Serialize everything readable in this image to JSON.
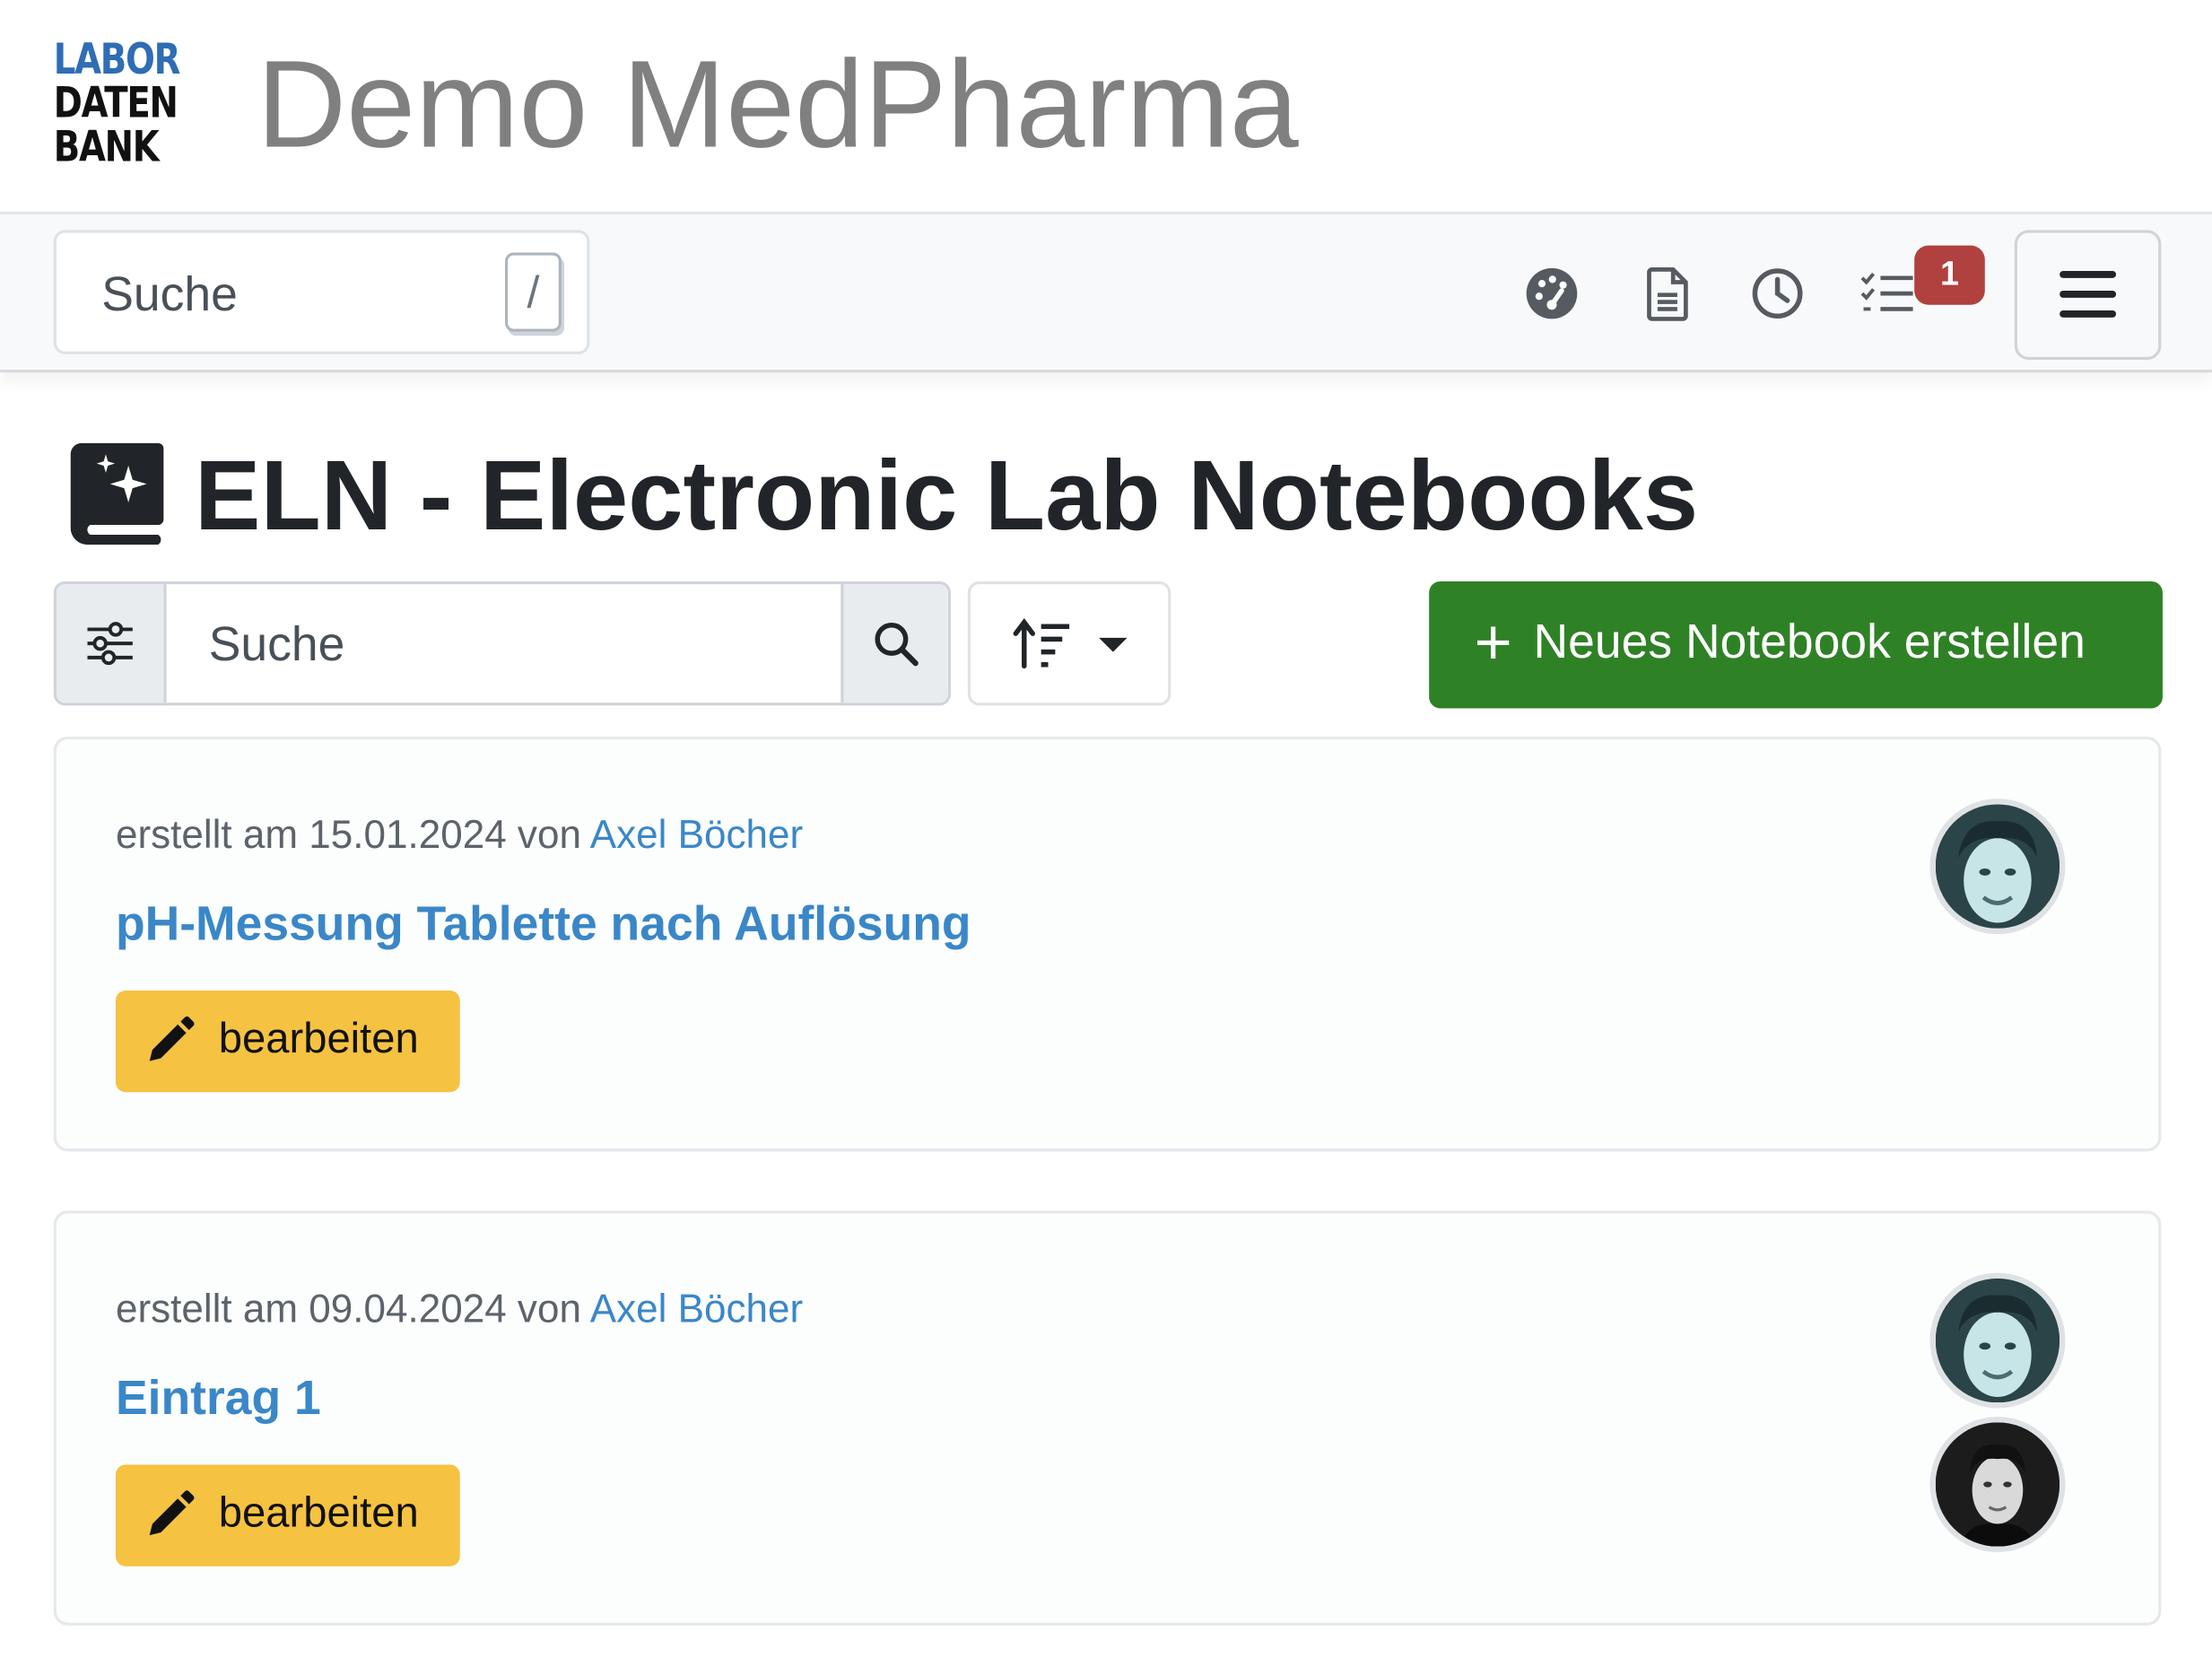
{
  "header": {
    "logo_lines": [
      "LABOR",
      "DATEN",
      "BANK"
    ],
    "site_title": "Demo MedPharma"
  },
  "navbar": {
    "search_placeholder": "Suche",
    "search_shortcut": "/",
    "icons": [
      "dashboard-icon",
      "document-icon",
      "clock-icon",
      "tasks-icon",
      "hamburger-menu-icon"
    ],
    "tasks_badge": "1"
  },
  "page": {
    "title": "ELN - Electronic Lab Notebooks",
    "search_placeholder": "Suche",
    "new_button_label": "Neues Notebook erstellen"
  },
  "entries": [
    {
      "created_prefix": "erstellt am 15.01.2024 von",
      "author": "Axel Böcher",
      "title": "pH-Messung Tablette nach Auflösung",
      "edit_label": "bearbeiten"
    },
    {
      "created_prefix": "erstellt am 09.04.2024 von",
      "author": "Axel Böcher",
      "title": "Eintrag 1",
      "edit_label": "bearbeiten"
    }
  ],
  "colors": {
    "primary_green": "#2f8126",
    "edit_yellow": "#f5c242",
    "link_blue": "#3a87c8",
    "badge_red": "#b0413e",
    "logo_blue": "#2f6db4"
  }
}
